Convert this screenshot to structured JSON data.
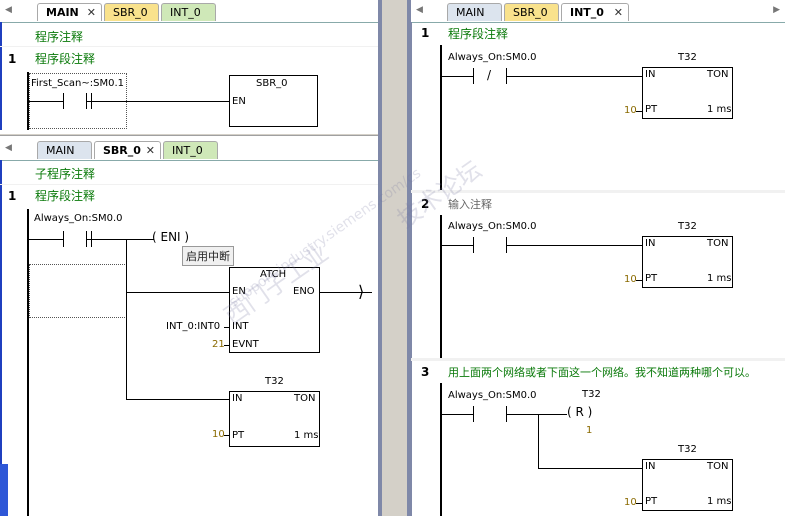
{
  "tabs_top_left": [
    "MAIN",
    "SBR_0",
    "INT_0"
  ],
  "tabs_mid_left": [
    "MAIN",
    "SBR_0",
    "INT_0"
  ],
  "tabs_right": [
    "MAIN",
    "SBR_0",
    "INT_0"
  ],
  "main": {
    "comment": "程序注释",
    "net1_num": "1",
    "net1_comment": "程序段注释",
    "contact1": "First_Scan~:SM0.1",
    "box_title": "SBR_0",
    "box_en": "EN"
  },
  "sbr": {
    "comment": "子程序注释",
    "net1_num": "1",
    "net1_comment": "程序段注释",
    "contact": "Always_On:SM0.0",
    "eni": "ENI",
    "tooltip": "启用中断",
    "atch_title": "ATCH",
    "en": "EN",
    "eno": "ENO",
    "int_pin": "INT",
    "evnt_pin": "EVNT",
    "int_val": "INT_0:INT0",
    "evnt_val": "21",
    "t32_title": "T32",
    "in": "IN",
    "ton": "TON",
    "pt": "PT",
    "pt_val": "10",
    "ms": "1 ms"
  },
  "intp": {
    "comment": "程序注释",
    "net1_num": "1",
    "net1_comment": "程序段注释",
    "contact1": "Always_On:SM0.0",
    "not": "/",
    "t32_a": "T32",
    "in": "IN",
    "ton": "TON",
    "pt": "PT",
    "pt_val": "10",
    "ms": "1 ms",
    "net2_num": "2",
    "net2_comment": "输入注释",
    "contact2": "Always_On:SM0.0",
    "t32_b": "T32",
    "net3_num": "3",
    "net3_comment": "用上面两个网络或者下面这一个网络。我不知道两种哪个可以。",
    "contact3": "Always_On:SM0.0",
    "coil_label": "T32",
    "coil": "R",
    "coil_val": "1",
    "t32_c": "T32"
  },
  "watermark": [
    "西门子工业",
    "support.industry.siemens.com/cs",
    "技术论坛"
  ]
}
